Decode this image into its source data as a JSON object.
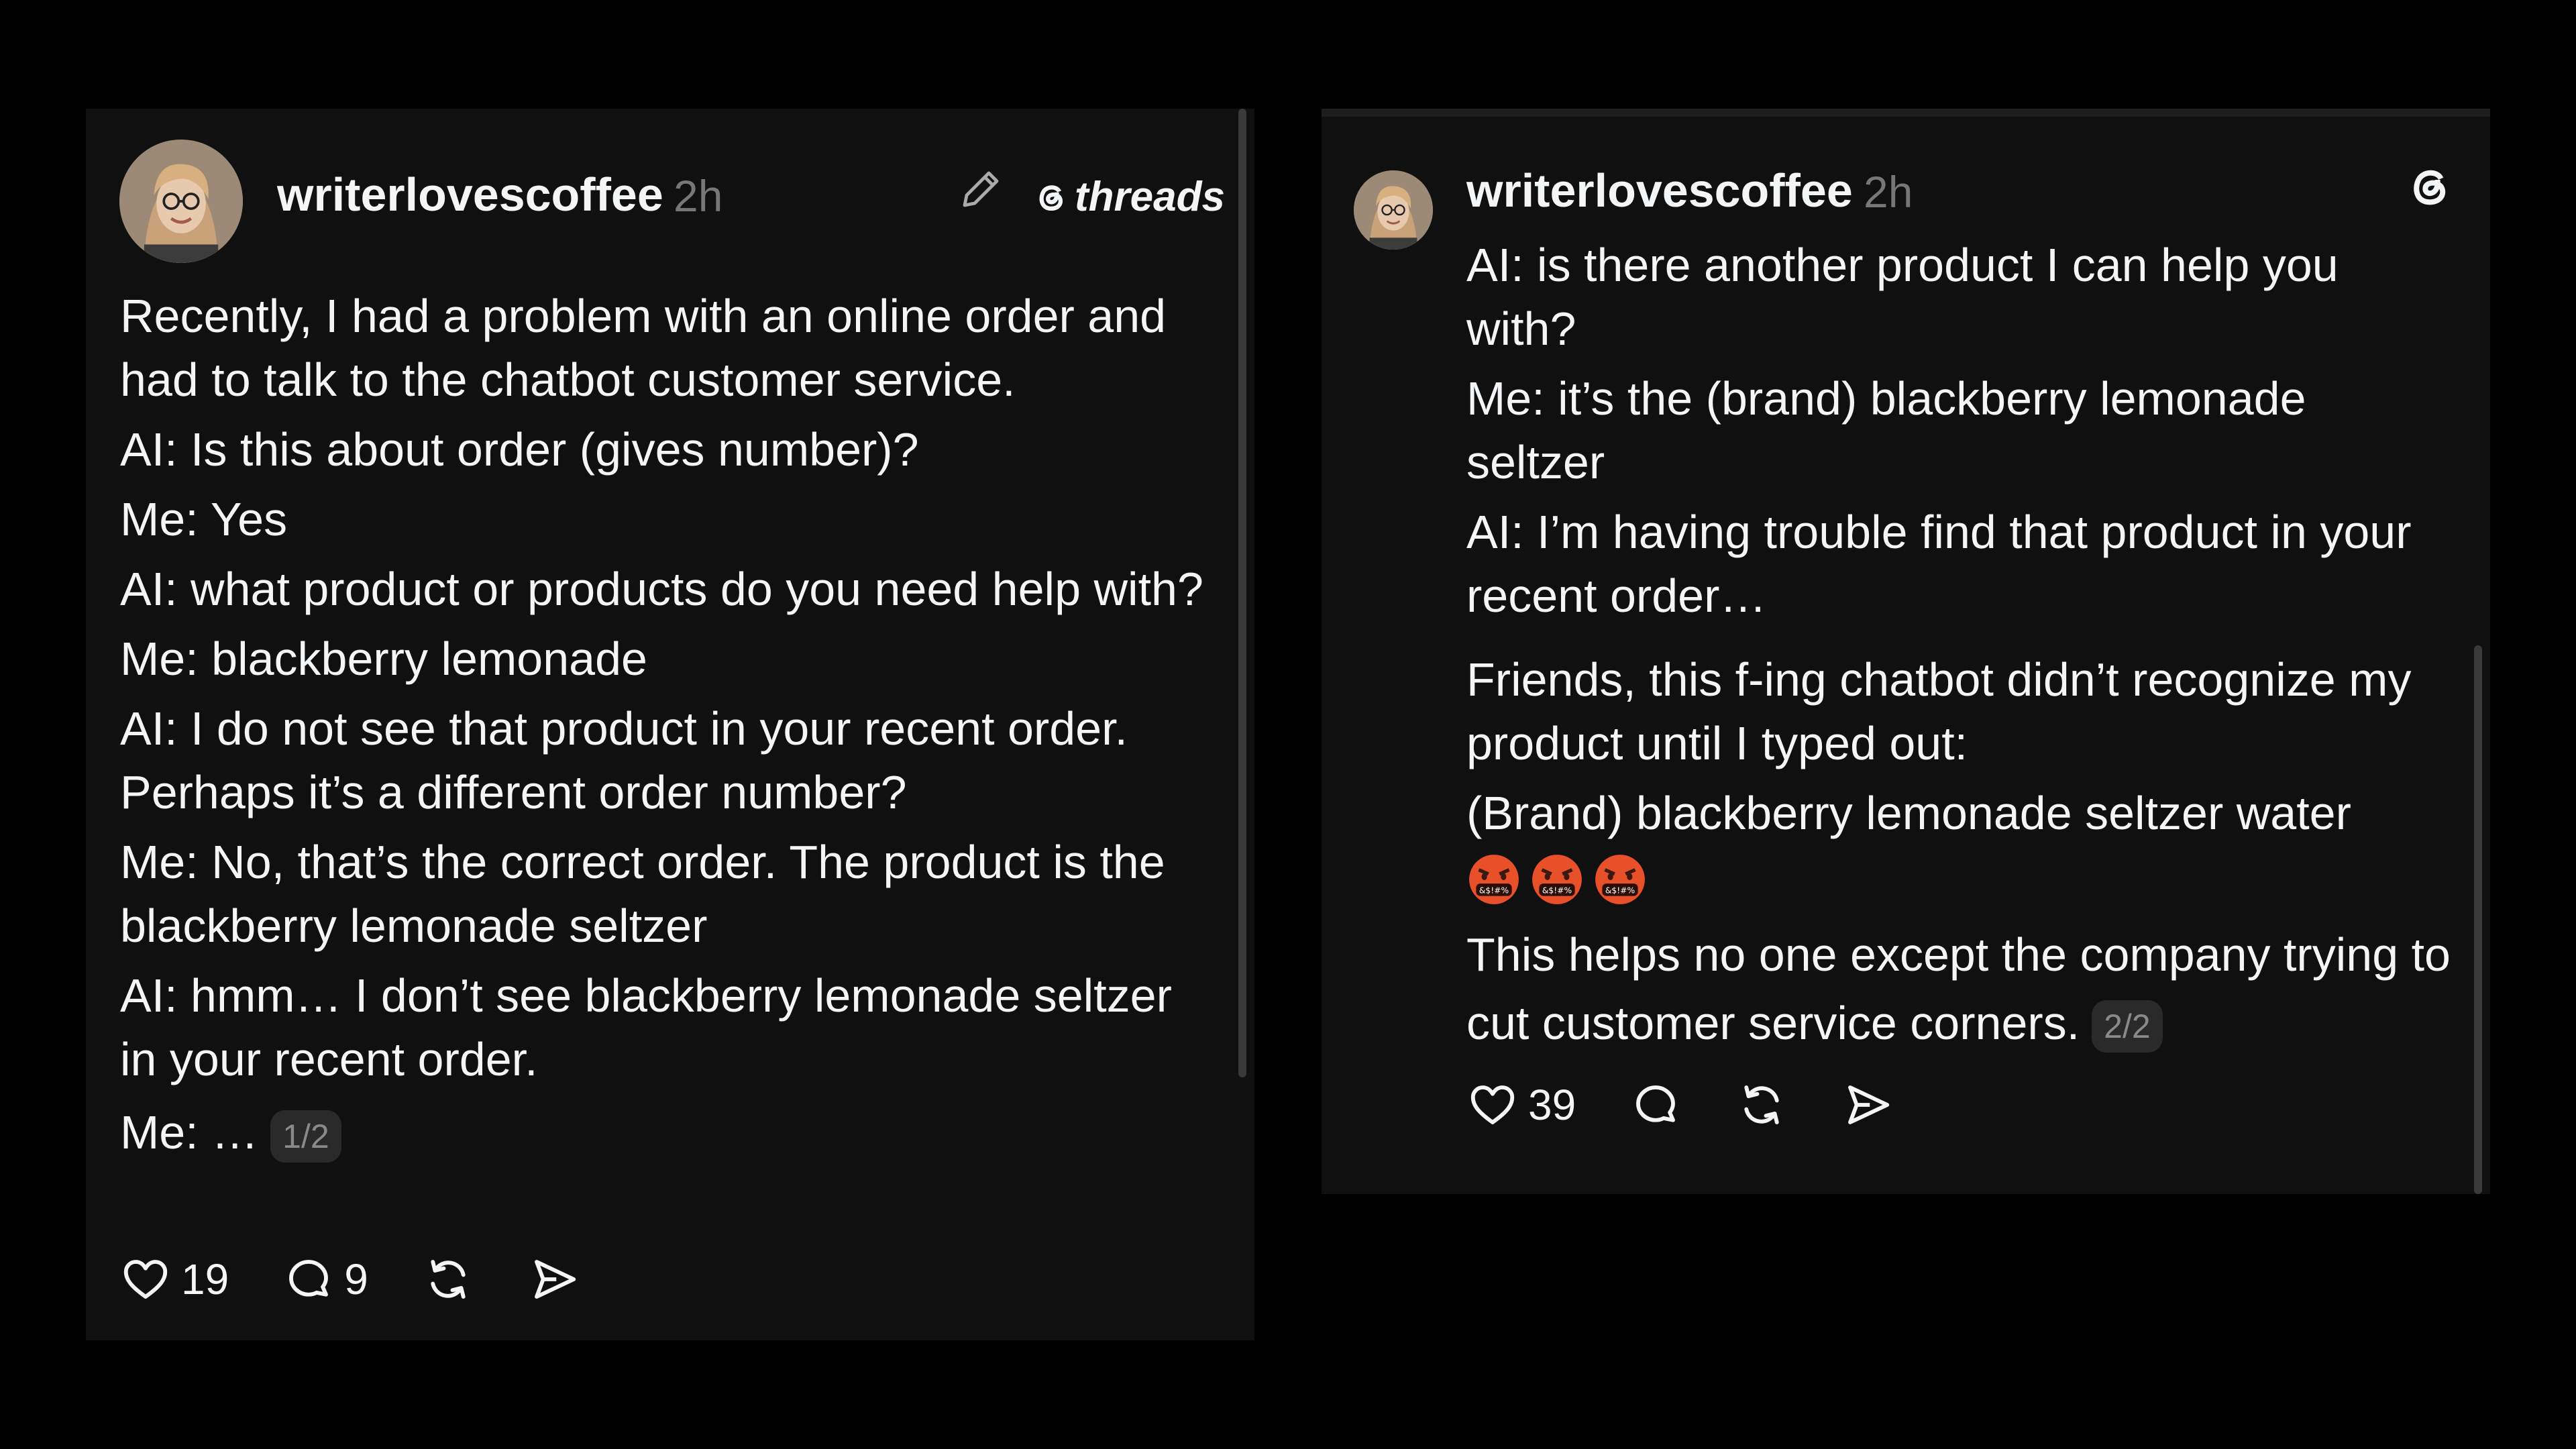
{
  "left_post": {
    "username": "writerlovescoffee",
    "time": "2h",
    "brand": "threads",
    "paragraphs": [
      "Recently, I had a problem with an online order and had to talk to the chatbot customer service.",
      "AI: Is this about order (gives number)?",
      "Me: Yes",
      "AI: what product or products do you need help with?",
      "Me: blackberry lemonade",
      "AI: I do not see that product in your recent order. Perhaps it’s a different order number?",
      "Me: No, that’s the correct order. The product is the blackberry lemonade seltzer",
      "AI: hmm… I don’t see blackberry lemonade seltzer in your recent order."
    ],
    "last_line": "Me: …",
    "page_badge": "1/2",
    "likes": "19",
    "replies": "9",
    "icons": [
      "heart-icon",
      "comment-icon",
      "repost-icon",
      "share-icon",
      "edit-pencil-icon",
      "threads-logo-icon"
    ]
  },
  "right_post": {
    "username": "writerlovescoffee",
    "time": "2h",
    "paragraphs": [
      "AI: is there another product I can help you with?",
      "Me: it’s the (brand) blackberry lemonade seltzer",
      "AI: I’m having trouble find that product in your recent order…",
      "Friends, this f-ing chatbot didn’t recognize my product until I typed out:",
      "(Brand) blackberry lemonade seltzer water"
    ],
    "emoji_count": 3,
    "emoji_name": "face-with-symbols-on-mouth",
    "closing": "This helps no one except the company trying to cut customer service corners.",
    "page_badge": "2/2",
    "likes": "39",
    "icons": [
      "heart-icon",
      "comment-icon",
      "repost-icon",
      "share-icon",
      "threads-logo-icon"
    ]
  },
  "colors": {
    "background": "#000000",
    "card": "#101010",
    "text": "#f3f5f7",
    "muted": "#777777"
  }
}
